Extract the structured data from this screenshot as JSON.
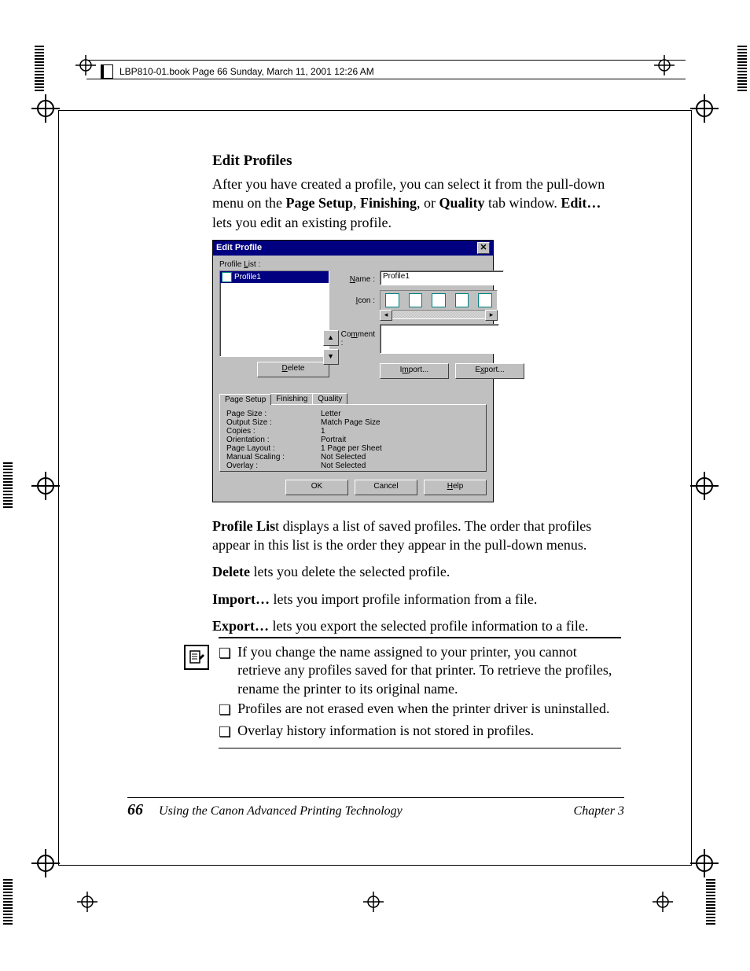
{
  "header": {
    "meta": "LBP810-01.book  Page 66  Sunday, March 11, 2001  12:26 AM"
  },
  "section": {
    "title": "Edit Profiles",
    "intro_before": "After you have created a profile, you can select it from the pull-down menu on the ",
    "intro_b1": "Page Setup",
    "intro_mid1": ", ",
    "intro_b2": "Finishing",
    "intro_mid2": ", or ",
    "intro_b3": "Quality",
    "intro_mid3": " tab window. ",
    "intro_b4": "Edit…",
    "intro_after": " lets you edit an existing profile."
  },
  "dialog": {
    "title": "Edit Profile",
    "labels": {
      "profile_list": "Profile List :",
      "name": "Name :",
      "icon": "Icon :",
      "comment": "Comment :"
    },
    "name_value": "Profile1",
    "selected_profile": "Profile1",
    "buttons": {
      "delete": "Delete",
      "import": "Import...",
      "export": "Export...",
      "ok": "OK",
      "cancel": "Cancel",
      "help": "Help"
    },
    "tabs": {
      "page_setup": "Page Setup",
      "finishing": "Finishing",
      "quality": "Quality"
    },
    "settings": {
      "rows": [
        {
          "k": "Page Size :",
          "v": "Letter"
        },
        {
          "k": "Output Size :",
          "v": "Match Page Size"
        },
        {
          "k": "Copies :",
          "v": "1"
        },
        {
          "k": "Orientation :",
          "v": "Portrait"
        },
        {
          "k": "Page Layout :",
          "v": "1 Page per Sheet"
        },
        {
          "k": "Manual Scaling :",
          "v": "Not Selected"
        },
        {
          "k": "Overlay :",
          "v": "Not Selected"
        }
      ]
    }
  },
  "descriptions": {
    "profile_list_bold": "Profile Lis",
    "profile_list_rest": "t displays a list of saved profiles. The order that profiles appear in this list is the order they appear in the pull-down menus.",
    "delete_bold": "Delete",
    "delete_rest": " lets you delete the selected profile.",
    "import_bold": "Import…",
    "import_rest": " lets you import profile information from a file.",
    "export_bold": "Export…",
    "export_rest": " lets you export the selected profile information to a file."
  },
  "notes": {
    "n1": "If you change the name assigned to your printer, you cannot retrieve any profiles saved for that printer. To retrieve the profiles, rename the printer to its original name.",
    "n2": "Profiles are not erased even when the printer driver is uninstalled.",
    "n3": "Overlay history information is not stored in profiles."
  },
  "footer": {
    "page_number": "66",
    "book_title": "Using the Canon Advanced Printing Technology",
    "chapter": "Chapter 3"
  }
}
